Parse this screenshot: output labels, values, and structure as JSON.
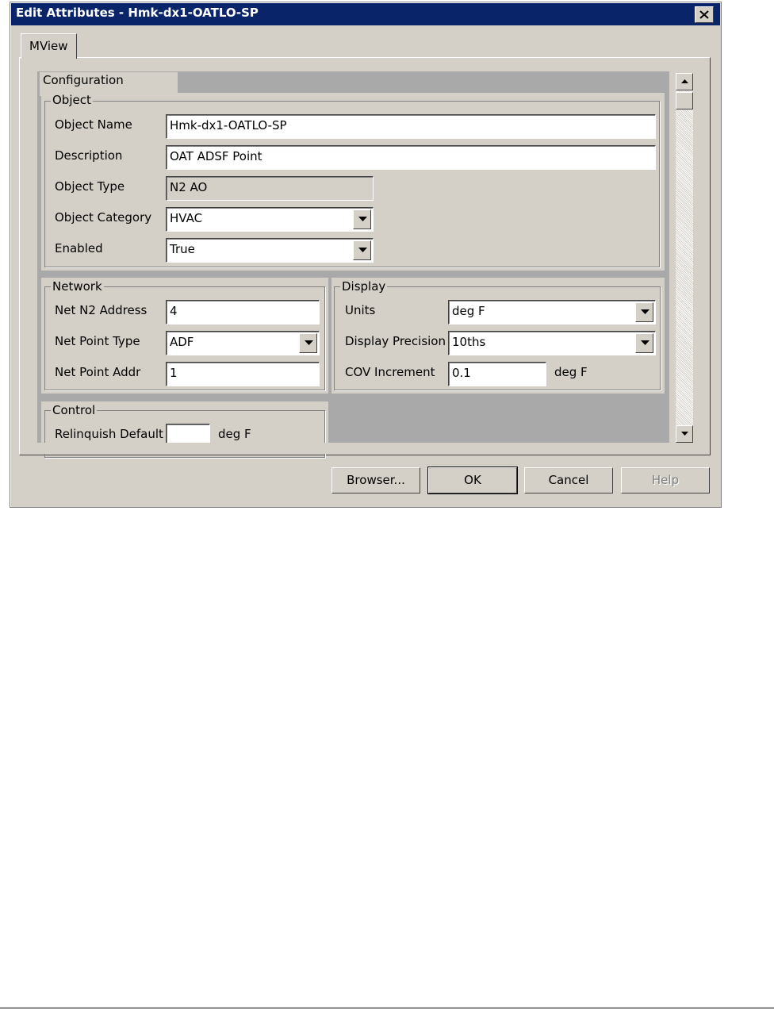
{
  "window": {
    "title": "Edit Attributes - Hmk-dx1-OATLO-SP"
  },
  "tabs": [
    {
      "label": "MView",
      "active": true
    }
  ],
  "config_tab": {
    "label": "Configuration"
  },
  "object_group": {
    "label": "Object",
    "fields": {
      "object_name": {
        "label": "Object Name",
        "value": "Hmk-dx1-OATLO-SP"
      },
      "description": {
        "label": "Description",
        "value": "OAT ADSF Point"
      },
      "object_type": {
        "label": "Object Type",
        "value": "N2 AO"
      },
      "object_category": {
        "label": "Object Category",
        "value": "HVAC"
      },
      "enabled": {
        "label": "Enabled",
        "value": "True"
      }
    }
  },
  "network_group": {
    "label": "Network",
    "fields": {
      "n2_address": {
        "label": "Net N2 Address",
        "value": "4"
      },
      "point_type": {
        "label": "Net Point Type",
        "value": "ADF"
      },
      "point_addr": {
        "label": "Net Point Addr",
        "value": "1"
      }
    }
  },
  "display_group": {
    "label": "Display",
    "fields": {
      "units": {
        "label": "Units",
        "value": "deg F"
      },
      "precision": {
        "label": "Display Precision",
        "value": "10ths"
      },
      "cov": {
        "label": "COV Increment",
        "value": "0.1",
        "unit": "deg F"
      }
    }
  },
  "control_group": {
    "label": "Control",
    "fields": {
      "relinquish": {
        "label": "Relinquish Default",
        "value": "",
        "unit": "deg F"
      }
    }
  },
  "buttons": {
    "browser": "Browser...",
    "ok": "OK",
    "cancel": "Cancel",
    "help": "Help"
  },
  "colors": {
    "titlebar": "#0a246a",
    "dialog_face": "#d4d0c8",
    "viewport_bg": "#a9a9a9"
  }
}
